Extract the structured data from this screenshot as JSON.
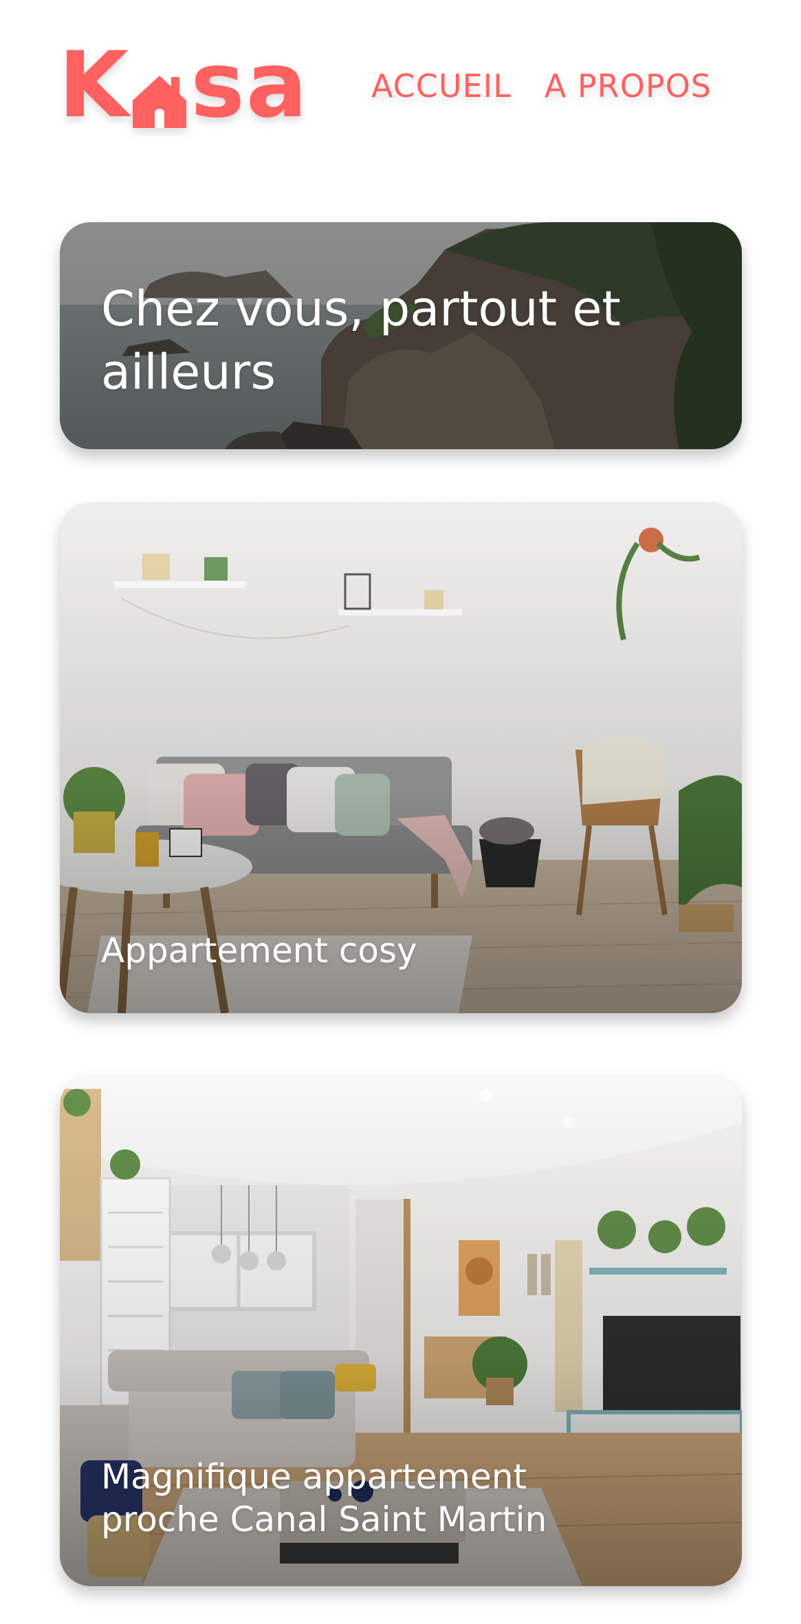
{
  "header": {
    "logo": {
      "part1": "K",
      "part2": "sa",
      "aria": "Kasa logo"
    },
    "nav": [
      {
        "label": "ACCUEIL"
      },
      {
        "label": "A PROPOS"
      }
    ]
  },
  "banner": {
    "title": "Chez vous, partout et ailleurs"
  },
  "listings": [
    {
      "title": "Appartement cosy"
    },
    {
      "title": "Magnifique appartement proche Canal Saint Martin"
    }
  ],
  "colors": {
    "brand": "#FF6060",
    "background": "#FFFFFF",
    "caption_text": "#FFFFFF"
  },
  "icons": {
    "logo_house": "house-icon"
  }
}
